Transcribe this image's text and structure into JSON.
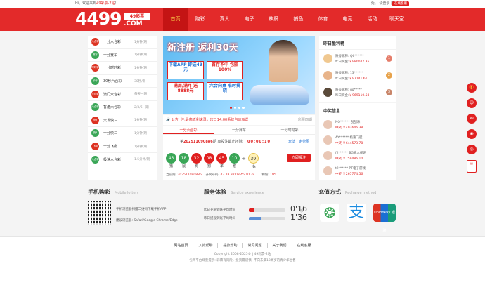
{
  "topbar": {
    "greeting": "Hi，欢迎来到",
    "site_name": "49彩票-2站",
    "greeting_suffix": "！",
    "right_links": "免，  请登录  用户注册",
    "service": "在线客服"
  },
  "logo": {
    "number": "4499",
    "tag": "49彩票",
    "com": ".COM"
  },
  "nav": [
    "首页",
    "购彩",
    "真人",
    "电子",
    "棋牌",
    "捕鱼",
    "体育",
    "电竞",
    "活动",
    "聊天室"
  ],
  "games": [
    {
      "icon": "六合彩",
      "name": "一分六合彩",
      "time": "1分钟/期"
    },
    {
      "icon": "赛车",
      "name": "一分赛车",
      "time": "1分钟/期"
    },
    {
      "icon": "时时彩",
      "name": "一分时时彩",
      "time": "1分钟/期"
    },
    {
      "icon": "秒秒",
      "name": "30秒六合彩",
      "time": "30秒/期"
    },
    {
      "icon": "六合彩",
      "name": "澳门六合彩",
      "time": "每天一期"
    },
    {
      "icon": "六合彩",
      "name": "香港六合彩",
      "time": "2/3/6一期"
    },
    {
      "icon": "快3",
      "name": "大发快三",
      "time": "1分钟/期"
    },
    {
      "icon": "快3",
      "name": "一分快三",
      "time": "1分钟/期"
    },
    {
      "icon": "飞艇",
      "name": "一分飞艇",
      "time": "1分钟/期"
    },
    {
      "icon": "六合彩",
      "name": "极速六合彩",
      "time": "1.5分钟/期"
    }
  ],
  "banner": {
    "headline": "新注册 返利30天",
    "box1": "下载APP 即送49元",
    "box2": "首存不中 包赔100%",
    "box3": "满周/满月 送8888元",
    "box4": "六合向桌 准时揭晓"
  },
  "notice": {
    "text": "公告: 注:最高返利速录，次日14:00系统自动派送",
    "more": "彩票四期"
  },
  "draw": {
    "tabs": [
      "一分六合彩",
      "一分赛车",
      "一分时时彩"
    ],
    "issue_label": "第",
    "issue": "202511090886",
    "issue_suffix": "期 离投注截止还剩:",
    "countdown": "00:00:10",
    "links": "玩法 | 走势图",
    "balls": [
      {
        "num": "43",
        "zodiac": "猪",
        "color": "g"
      },
      {
        "num": "18",
        "zodiac": "鼠",
        "color": "g"
      },
      {
        "num": "32",
        "zodiac": "狗",
        "color": "r"
      },
      {
        "num": "08",
        "zodiac": "狗",
        "color": "r"
      },
      {
        "num": "45",
        "zodiac": "羊",
        "color": "r"
      },
      {
        "num": "10",
        "zodiac": "猴",
        "color": "g"
      }
    ],
    "special": {
      "num": "39",
      "zodiac": "兔"
    },
    "bet": "立即投注",
    "current_label": "当前期:",
    "current": "202511090885",
    "open_label": "开奖号码:",
    "open_numbers": "43 18 32 08 45 10 39",
    "sum_label": "和值:",
    "sum": "195"
  },
  "winners": {
    "title": "昨日盈利榜",
    "items": [
      {
        "acct": "账号昵称: Q6******",
        "win": "昨日奖金:",
        "amount": "￥980047.35",
        "rank": "1"
      },
      {
        "acct": "账号昵称: 13******",
        "win": "昨日奖金:",
        "amount": "￥97141.61",
        "rank": "2"
      },
      {
        "acct": "账号昵称: qq*****",
        "win": "昨日奖金:",
        "amount": "￥969110.58",
        "rank": "3"
      }
    ]
  },
  "news": {
    "title": "中奖信息",
    "items": [
      {
        "who": "NO****** 刮刮乐",
        "amount": "中奖 ￥402646.38"
      },
      {
        "who": "4Y****** 极速飞艇",
        "amount": "中奖 ￥644573.78"
      },
      {
        "who": "f2****** BG真人视讯",
        "amount": "中奖 ￥759486.10"
      },
      {
        "who": "t2****** PT电子游戏",
        "amount": "中奖 ￥265774.56"
      }
    ]
  },
  "mobile": {
    "title": "手机购彩",
    "sub": "Mobile lottery",
    "line1": "手机浏览器扫描二维码下载手机APP",
    "line2": "建议浏览器: Safari/Google Chrome/Edge"
  },
  "service": {
    "title": "服务体验",
    "sub": "Service experience",
    "rows": [
      {
        "label": "昨日充值到账平均时间",
        "value": "0'16",
        "unit": "秒",
        "fill": 0.15
      },
      {
        "label": "昨日提现到账平均时间",
        "value": "1'36",
        "unit": "秒",
        "fill": 0.35
      }
    ]
  },
  "recharge": {
    "title": "充值方式",
    "sub": "Recharge method",
    "methods": [
      "微信",
      "支付宝",
      "UnionPay 银联"
    ]
  },
  "footer": {
    "links": [
      "网站首页",
      "入款帮助",
      "提款帮助",
      "常见问题",
      "关于我们",
      "在线客服"
    ],
    "copyright": "Copyright 2008-2025© | 49彩票-2站",
    "warning": "包网平台郑重提示: 彩票有风险，投资需谨慎!  不向未满18周岁的青少年出售"
  },
  "colors": {
    "brand": "#e32a2a",
    "active_nav": "#c41414",
    "text_red": "#e02020"
  }
}
